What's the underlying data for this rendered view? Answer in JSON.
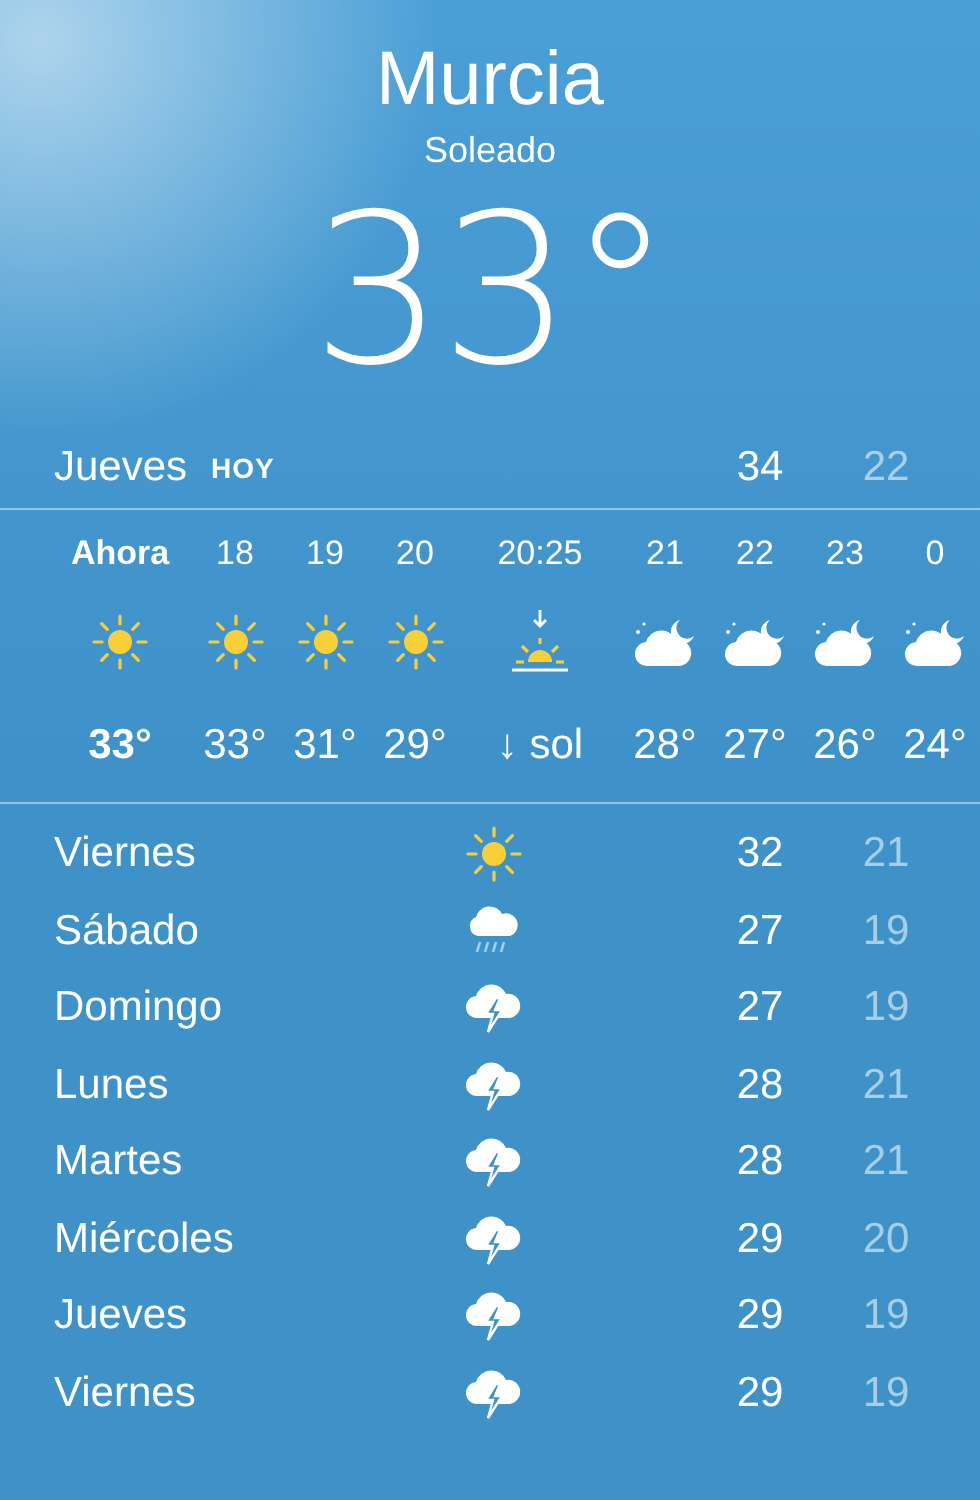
{
  "location": {
    "city": "Murcia",
    "condition": "Soleado",
    "temperature": "33°"
  },
  "today": {
    "day": "Jueves",
    "label": "HOY",
    "high": "34",
    "low": "22"
  },
  "hourly": [
    {
      "time": "Ahora",
      "kind": "sun",
      "temp": "33°",
      "current": true
    },
    {
      "time": "18",
      "kind": "sun",
      "temp": "33°",
      "current": false
    },
    {
      "time": "19",
      "kind": "sun",
      "temp": "31°",
      "current": false
    },
    {
      "time": "20",
      "kind": "sun",
      "temp": "29°",
      "current": false
    },
    {
      "time": "20:25",
      "kind": "sunset",
      "temp": "↓ sol",
      "current": false
    },
    {
      "time": "21",
      "kind": "moon-cloud",
      "temp": "28°",
      "current": false
    },
    {
      "time": "22",
      "kind": "moon-cloud",
      "temp": "27°",
      "current": false
    },
    {
      "time": "23",
      "kind": "moon-cloud",
      "temp": "26°",
      "current": false
    },
    {
      "time": "0",
      "kind": "moon-cloud",
      "temp": "24°",
      "current": false
    }
  ],
  "daily": [
    {
      "day": "Viernes",
      "kind": "sun",
      "high": "32",
      "low": "21"
    },
    {
      "day": "Sábado",
      "kind": "rain",
      "high": "27",
      "low": "19"
    },
    {
      "day": "Domingo",
      "kind": "storm",
      "high": "27",
      "low": "19"
    },
    {
      "day": "Lunes",
      "kind": "storm",
      "high": "28",
      "low": "21"
    },
    {
      "day": "Martes",
      "kind": "storm",
      "high": "28",
      "low": "21"
    },
    {
      "day": "Miércoles",
      "kind": "storm",
      "high": "29",
      "low": "20"
    },
    {
      "day": "Jueves",
      "kind": "storm",
      "high": "29",
      "low": "19"
    },
    {
      "day": "Viernes",
      "kind": "storm",
      "high": "29",
      "low": "19"
    }
  ]
}
